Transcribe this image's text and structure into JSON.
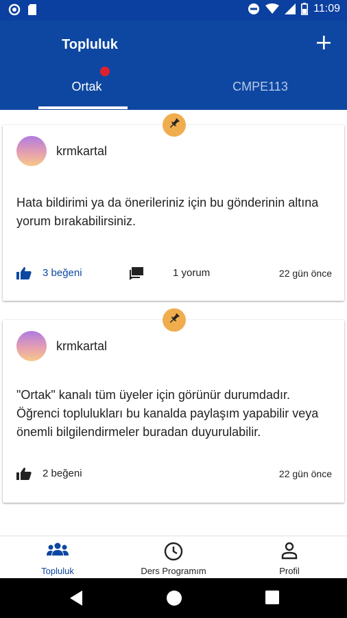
{
  "status_bar": {
    "time": "11:09",
    "left_icons": [
      "sync-circle-icon",
      "sd-card-icon"
    ],
    "right_icons": [
      "do-not-disturb-icon",
      "wifi-icon",
      "signal-icon",
      "battery-icon"
    ]
  },
  "app_bar": {
    "title": "Topluluk",
    "add_icon": "plus-icon",
    "tabs": [
      {
        "label": "Ortak",
        "selected": true,
        "has_notification": true
      },
      {
        "label": "CMPE113",
        "selected": false,
        "has_notification": false
      }
    ]
  },
  "posts": [
    {
      "pinned": true,
      "author": "krmkartal",
      "body": "Hata bildirimi ya da önerileriniz için bu gönderinin altına yorum bırakabilirsiniz.",
      "likes": "3 beğeni",
      "liked": true,
      "comments": "1 yorum",
      "time": "22 gün önce"
    },
    {
      "pinned": true,
      "author": "krmkartal",
      "body": "\"Ortak\" kanalı tüm üyeler için görünür durumdadır. Öğrenci toplulukları bu kanalda paylaşım yapabilir veya önemli bilgilendirmeler buradan duyurulabilir.",
      "likes": "2 beğeni",
      "liked": false,
      "time": "22 gün önce"
    }
  ],
  "bottom_nav": [
    {
      "label": "Topluluk",
      "icon": "people-icon",
      "active": true
    },
    {
      "label": "Ders Programım",
      "icon": "clock-icon",
      "active": false
    },
    {
      "label": "Profil",
      "icon": "person-icon",
      "active": false
    }
  ],
  "colors": {
    "primary": "#0d47a1",
    "status_bar": "#0b3fa0",
    "notification_dot": "#e0202e",
    "pin_badge": "#f0ad4e"
  }
}
